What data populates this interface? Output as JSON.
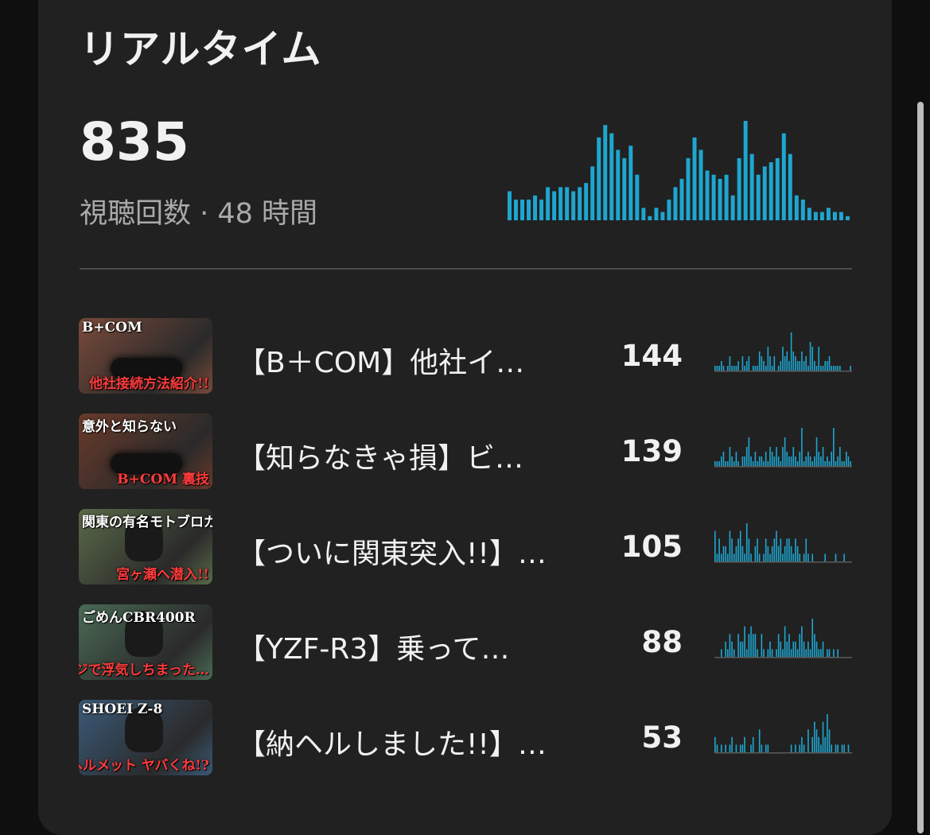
{
  "header": {
    "title": "リアルタイム"
  },
  "summary": {
    "views": "835",
    "caption": "視聴回数 · 48 時間"
  },
  "colors": {
    "accent": "#1ea6d0",
    "background": "#212121",
    "text": "#f1f1f1",
    "muted": "#aaaaaa"
  },
  "chart_data": {
    "type": "bar",
    "title": "",
    "values": [
      7,
      5,
      5,
      5,
      6,
      5,
      8,
      7,
      8,
      8,
      7,
      8,
      9,
      13,
      20,
      23,
      21,
      17,
      15,
      18,
      11,
      3,
      1,
      3,
      2,
      5,
      8,
      10,
      15,
      20,
      17,
      12,
      11,
      10,
      11,
      6,
      15,
      24,
      16,
      11,
      13,
      14,
      15,
      21,
      16,
      6,
      5,
      3,
      2,
      2,
      3,
      2,
      2,
      1
    ]
  },
  "videos": [
    {
      "title": "【B＋COM】他社イ…",
      "views": "144",
      "thumb": {
        "top_text": "B+COM",
        "bottom_text": "他社接続方法紹介!!",
        "bg": "#7a4a3a",
        "icon": "intercom-device-icon"
      },
      "sparkline": [
        1,
        1,
        1,
        2,
        1,
        0,
        1,
        3,
        1,
        1,
        1,
        2,
        0,
        3,
        1,
        2,
        3,
        0,
        1,
        1,
        1,
        4,
        3,
        2,
        1,
        5,
        3,
        1,
        3,
        0,
        1,
        2,
        5,
        3,
        4,
        2,
        8,
        4,
        3,
        2,
        2,
        4,
        2,
        3,
        1,
        6,
        5,
        2,
        1,
        5,
        1,
        1,
        2,
        2,
        3,
        1,
        1,
        1,
        1,
        1,
        0,
        0,
        0,
        0,
        1
      ]
    },
    {
      "title": "【知らなきゃ損】ビ…",
      "views": "139",
      "thumb": {
        "top_text": "意外と知らない",
        "bottom_text": "B+COM 裏技",
        "bg": "#6a3a2a",
        "icon": "intercom-device-icon"
      },
      "sparkline": [
        1,
        1,
        1,
        2,
        3,
        1,
        1,
        4,
        2,
        1,
        3,
        1,
        0,
        2,
        2,
        4,
        6,
        2,
        1,
        3,
        1,
        2,
        2,
        1,
        3,
        1,
        4,
        3,
        2,
        4,
        2,
        1,
        4,
        6,
        3,
        2,
        2,
        4,
        2,
        1,
        3,
        8,
        1,
        2,
        3,
        2,
        1,
        2,
        6,
        3,
        2,
        4,
        1,
        2,
        1,
        3,
        8,
        1,
        2,
        4,
        1,
        1,
        3,
        2,
        1
      ]
    },
    {
      "title": "【ついに関東突入!!】…",
      "views": "105",
      "thumb": {
        "top_text": "関東の有名モトブロガー探しに",
        "bottom_text": "宮ヶ瀬へ潜入!!",
        "bg": "#5a6a48",
        "icon": "motorcycle-rider-icon"
      },
      "sparkline": [
        4,
        1,
        3,
        1,
        2,
        2,
        1,
        4,
        3,
        1,
        2,
        3,
        4,
        2,
        1,
        5,
        3,
        1,
        0,
        2,
        3,
        1,
        0,
        1,
        3,
        2,
        1,
        2,
        3,
        4,
        2,
        3,
        1,
        2,
        3,
        3,
        2,
        1,
        3,
        2,
        1,
        0,
        1,
        3,
        1,
        0,
        1,
        0,
        0,
        0,
        0,
        0,
        1,
        0,
        0,
        0,
        0,
        1,
        0,
        0,
        0,
        1,
        0,
        0,
        0
      ]
    },
    {
      "title": "【YZF-R3】乗って…",
      "views": "88",
      "thumb": {
        "top_text": "ごめんCBR400R",
        "bottom_text": "マジで浮気しちまった…",
        "bg": "#4a6a55",
        "icon": "motorcycle-icon"
      },
      "sparkline": [
        0,
        0,
        0,
        1,
        0,
        2,
        1,
        3,
        2,
        1,
        0,
        3,
        2,
        2,
        4,
        1,
        3,
        4,
        3,
        3,
        1,
        0,
        3,
        1,
        0,
        1,
        2,
        1,
        0,
        1,
        3,
        2,
        1,
        4,
        2,
        3,
        1,
        2,
        2,
        1,
        3,
        4,
        2,
        1,
        2,
        1,
        5,
        3,
        2,
        1,
        1,
        2,
        0,
        1,
        1,
        0,
        1,
        0,
        1,
        0,
        0,
        0,
        0,
        0,
        0
      ]
    },
    {
      "title": "【納ヘルしました!!】…",
      "views": "53",
      "thumb": {
        "top_text": "SHOEI Z-8",
        "bottom_text": "このヘルメット ヤバくね!?",
        "bg": "#3a5a78",
        "icon": "helmet-icon"
      },
      "sparkline": [
        2,
        1,
        0,
        1,
        0,
        1,
        0,
        1,
        2,
        0,
        1,
        0,
        1,
        1,
        2,
        0,
        0,
        1,
        2,
        0,
        0,
        3,
        1,
        0,
        1,
        1,
        0,
        0,
        0,
        0,
        0,
        0,
        0,
        0,
        0,
        0,
        1,
        0,
        1,
        0,
        1,
        2,
        1,
        0,
        3,
        0,
        2,
        4,
        3,
        2,
        1,
        4,
        2,
        5,
        3,
        1,
        0,
        1,
        1,
        0,
        1,
        1,
        0,
        1,
        0
      ]
    }
  ]
}
